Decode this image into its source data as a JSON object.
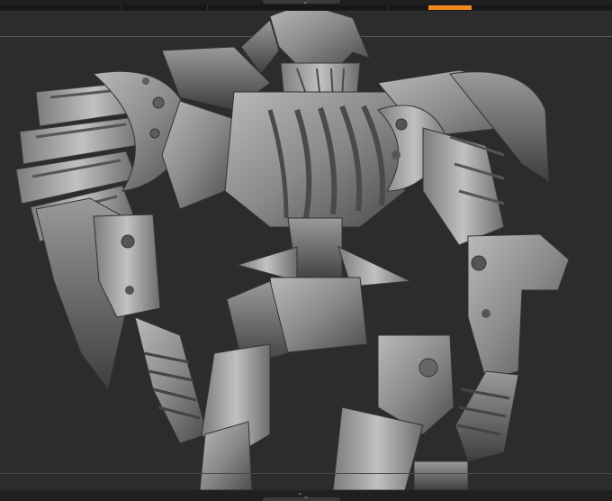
{
  "viewport": {
    "background": "#2c2c2c",
    "model_color": "#8e8e8e",
    "accent": "#f08a1c"
  },
  "top_bar": {
    "grip_glyph": "⌃⌄",
    "progress_fraction": 0.07
  },
  "bottom_bar": {
    "grip_glyph": "⌃⌄"
  },
  "icons": {
    "top_grip": "drag-handle-icon",
    "bottom_grip": "drag-handle-icon"
  }
}
